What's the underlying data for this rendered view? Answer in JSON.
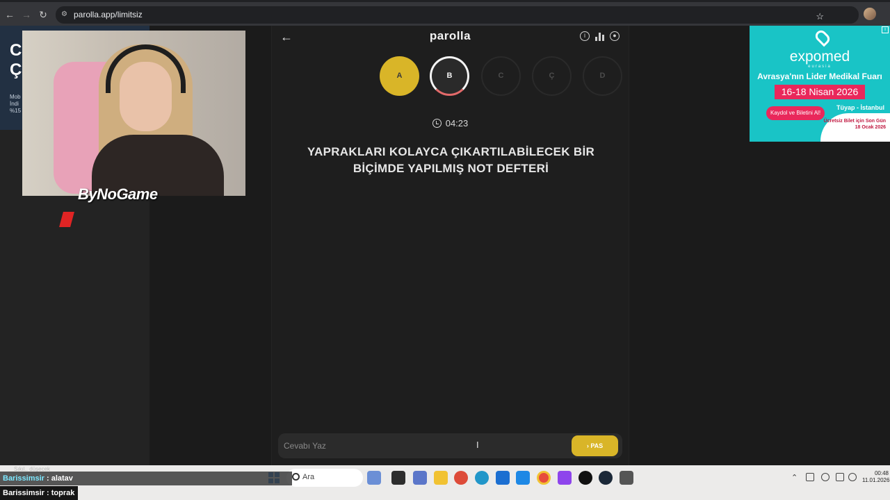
{
  "browser": {
    "url": "parolla.app/limitsiz",
    "back_icon": "arrow-left-icon",
    "forward_icon": "arrow-right-icon",
    "reload_icon": "reload-icon"
  },
  "left_ad": {
    "headline": "C\nÇ",
    "small_text": "Mob\nİndi\n%15"
  },
  "stream": {
    "overlay_brand": "ByNoGame"
  },
  "app": {
    "logo": "parolla",
    "letters": [
      {
        "label": "A",
        "state": "done"
      },
      {
        "label": "B",
        "state": "active"
      },
      {
        "label": "C",
        "state": "pending"
      },
      {
        "label": "Ç",
        "state": "pending"
      },
      {
        "label": "D",
        "state": "pending"
      }
    ],
    "timer": "04:23",
    "question": "YAPRAKLARI KOLAYCA ÇIKARTILABİLECEK BİR BİÇİMDE YAPILMIŞ NOT DEFTERİ",
    "answer_placeholder": "Cevabı Yaz",
    "answer_value": "",
    "pass_label": "PAS",
    "colors": {
      "accent": "#d9b528",
      "background": "#1e1e1e"
    }
  },
  "right_ad": {
    "brand": "expomed",
    "brand_sub": "eurasia",
    "line1": "Avrasya'nın Lider Medikal Fuarı",
    "dates": "16-18 Nisan 2026",
    "cta": "Kaydol ve Biletini Al!",
    "venue": "Tüyap - İstanbul",
    "footnote": "Ücretsiz Bilet için Son Gün 18 Ocak 2026"
  },
  "taskbar": {
    "search_placeholder": "Ara",
    "time": "00:48",
    "date": "11.01.2026"
  },
  "chat": {
    "ghost_text": "Sıkıl.. düşecek",
    "messages": [
      {
        "user": "Barissimsir",
        "text": "alatav"
      },
      {
        "user": "Barissimsir",
        "text": "toprak"
      }
    ]
  }
}
